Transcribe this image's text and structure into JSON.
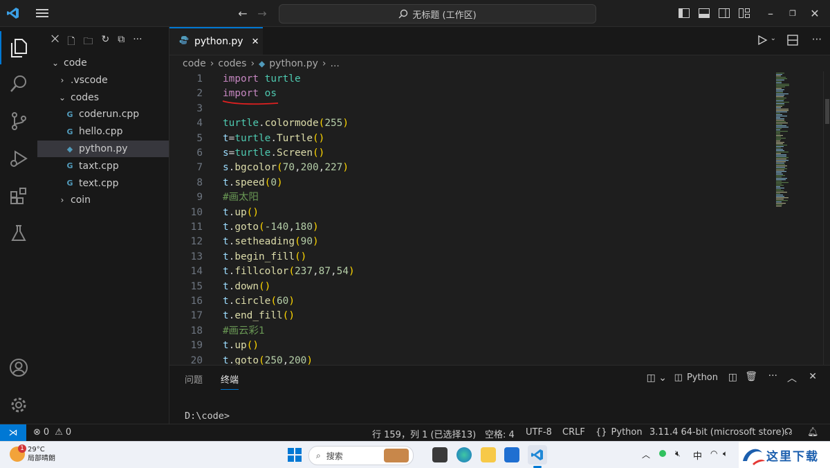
{
  "titlebar": {
    "search_text": "无标题 (工作区)"
  },
  "sidebar": {
    "tree": [
      {
        "label": "code",
        "kind": "folder-open",
        "depth": 0
      },
      {
        "label": ".vscode",
        "kind": "folder-closed",
        "depth": 1
      },
      {
        "label": "codes",
        "kind": "folder-open",
        "depth": 1
      },
      {
        "label": "coderun.cpp",
        "kind": "cpp",
        "depth": 2
      },
      {
        "label": "hello.cpp",
        "kind": "cpp",
        "depth": 2
      },
      {
        "label": "python.py",
        "kind": "py",
        "depth": 2,
        "selected": true
      },
      {
        "label": "taxt.cpp",
        "kind": "cpp",
        "depth": 2
      },
      {
        "label": "text.cpp",
        "kind": "cpp",
        "depth": 2
      },
      {
        "label": "coin",
        "kind": "folder-closed",
        "depth": 1
      }
    ]
  },
  "editor": {
    "tab_label": "python.py",
    "breadcrumb": [
      "code",
      "codes",
      "python.py",
      "..."
    ],
    "lines": [
      {
        "n": "1",
        "text": "import turtle"
      },
      {
        "n": "2",
        "text": "import os"
      },
      {
        "n": "3",
        "text": ""
      },
      {
        "n": "4",
        "text": "turtle.colormode(255)"
      },
      {
        "n": "5",
        "text": "t=turtle.Turtle()"
      },
      {
        "n": "6",
        "text": "s=turtle.Screen()"
      },
      {
        "n": "7",
        "text": "s.bgcolor(70,200,227)"
      },
      {
        "n": "8",
        "text": "t.speed(0)"
      },
      {
        "n": "9",
        "text": "#画太阳"
      },
      {
        "n": "10",
        "text": "t.up()"
      },
      {
        "n": "11",
        "text": "t.goto(-140,180)"
      },
      {
        "n": "12",
        "text": "t.setheading(90)"
      },
      {
        "n": "13",
        "text": "t.begin_fill()"
      },
      {
        "n": "14",
        "text": "t.fillcolor(237,87,54)"
      },
      {
        "n": "15",
        "text": "t.down()"
      },
      {
        "n": "16",
        "text": "t.circle(60)"
      },
      {
        "n": "17",
        "text": "t.end_fill()"
      },
      {
        "n": "18",
        "text": "#画云彩1"
      },
      {
        "n": "19",
        "text": "t.up()"
      },
      {
        "n": "20",
        "text": "t.goto(250,200)"
      }
    ]
  },
  "panel": {
    "tabs": [
      "问题",
      "终端"
    ],
    "active_tab": "终端",
    "terminal_kind": "Python",
    "terminal_text": "D:\\code>"
  },
  "statusbar": {
    "errors": "0",
    "warnings": "0",
    "cursor": "行 159，列 1 (已选择13)",
    "spaces": "空格: 4",
    "encoding": "UTF-8",
    "eol": "CRLF",
    "language": "Python",
    "interpreter": "3.11.4 64-bit (microsoft store)"
  },
  "taskbar": {
    "weather_temp": "29°C",
    "weather_desc": "局部晴朗",
    "weather_badge": "1",
    "search_label": "搜索",
    "ime": "中",
    "watermark": "这里下载"
  },
  "colors": {
    "accent": "#0078d4",
    "keyword": "#c586c0",
    "module": "#4ec9b0",
    "function": "#dcdcaa",
    "number": "#b5cea8",
    "comment": "#6a9955"
  }
}
